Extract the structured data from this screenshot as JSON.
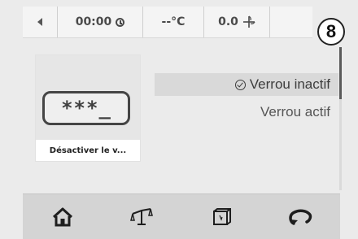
{
  "status_bar": {
    "time": "00:00",
    "temperature": "--°C",
    "speed": "0.0"
  },
  "step_number": "8",
  "tile": {
    "pin_display": "***_",
    "label": "Désactiver le v..."
  },
  "options": [
    {
      "label": "Verrou inactif",
      "selected": true
    },
    {
      "label": "Verrou actif",
      "selected": false
    }
  ],
  "bottom_nav": {
    "icons": [
      "home-icon",
      "scale-icon",
      "box-icon",
      "return-icon"
    ]
  },
  "icons": {
    "back": "back-arrow-icon",
    "clock": "clock-icon",
    "spin": "spin-icon",
    "check": "check-circle-icon"
  },
  "scroll": {
    "position": 0
  }
}
